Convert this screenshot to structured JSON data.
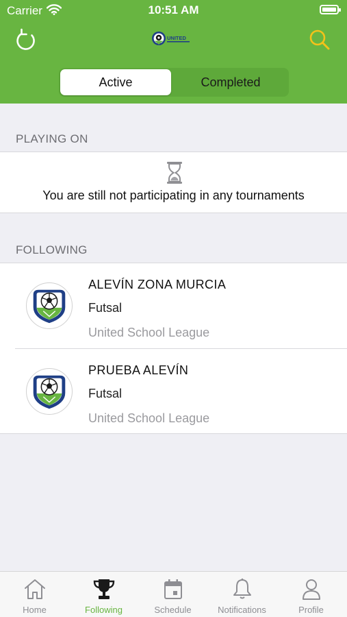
{
  "status_bar": {
    "carrier": "Carrier",
    "time": "10:51 AM"
  },
  "header": {
    "refresh_icon": "refresh-icon",
    "logo_text": "UNITED",
    "search_icon": "search-icon",
    "segments": {
      "active": "Active",
      "completed": "Completed"
    }
  },
  "playing": {
    "header": "PLAYING ON",
    "empty_icon": "hourglass-icon",
    "empty_text": "You are still not participating in any tournaments"
  },
  "following": {
    "header": "FOLLOWING",
    "items": [
      {
        "title": "ALEVÍN ZONA MURCIA",
        "sport": "Futsal",
        "league": "United School League"
      },
      {
        "title": "PRUEBA ALEVÍN",
        "sport": "Futsal",
        "league": "United School League"
      }
    ]
  },
  "tabbar": {
    "items": [
      {
        "label": "Home",
        "icon": "home-icon"
      },
      {
        "label": "Following",
        "icon": "trophy-icon"
      },
      {
        "label": "Schedule",
        "icon": "calendar-icon"
      },
      {
        "label": "Notifications",
        "icon": "bell-icon"
      },
      {
        "label": "Profile",
        "icon": "person-icon"
      }
    ],
    "selected": "Following"
  },
  "colors": {
    "brand_green": "#68b541",
    "search_yellow": "#f3c21a",
    "background": "#efeff4"
  }
}
